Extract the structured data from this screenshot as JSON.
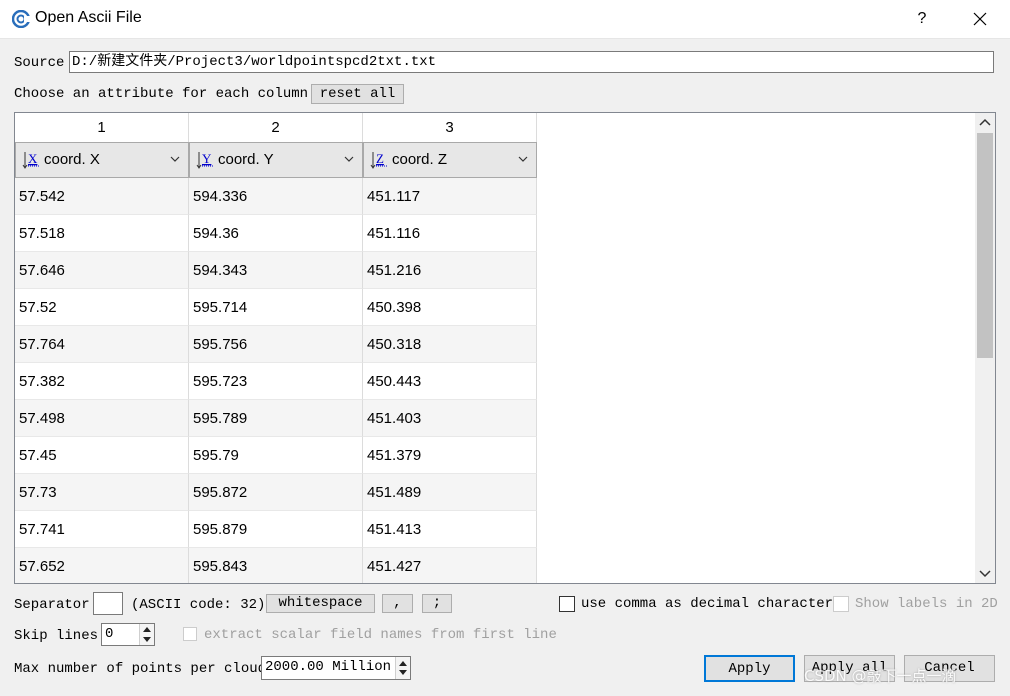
{
  "window": {
    "title": "Open Ascii File",
    "help": "?",
    "close_icon": "close-icon",
    "app_icon": "cloudcompare-icon"
  },
  "source": {
    "label": "Source",
    "value": "D:/新建文件夹/Project3/worldpointspcd2txt.txt"
  },
  "attributes": {
    "label": "Choose an attribute for each column:",
    "reset_label": "reset all"
  },
  "columns": [
    {
      "number": "1",
      "axis": "X",
      "label": "coord. X"
    },
    {
      "number": "2",
      "axis": "Y",
      "label": "coord. Y"
    },
    {
      "number": "3",
      "axis": "Z",
      "label": "coord. Z"
    }
  ],
  "rows": [
    [
      "57.542",
      "594.336",
      "451.117"
    ],
    [
      "57.518",
      "594.36",
      "451.116"
    ],
    [
      "57.646",
      "594.343",
      "451.216"
    ],
    [
      "57.52",
      "595.714",
      "450.398"
    ],
    [
      "57.764",
      "595.756",
      "450.318"
    ],
    [
      "57.382",
      "595.723",
      "450.443"
    ],
    [
      "57.498",
      "595.789",
      "451.403"
    ],
    [
      "57.45",
      "595.79",
      "451.379"
    ],
    [
      "57.73",
      "595.872",
      "451.489"
    ],
    [
      "57.741",
      "595.879",
      "451.413"
    ],
    [
      "57.652",
      "595.843",
      "451.427"
    ]
  ],
  "separator": {
    "label": "Separator",
    "value": "",
    "code_text": "(ASCII code: 32)",
    "whitespace_label": "whitespace",
    "comma_label": ",",
    "semicolon_label": ";"
  },
  "options": {
    "comma_decimal": "use comma as decimal character",
    "show_labels": "Show labels in 2D",
    "extract_names": "extract scalar field names from first line"
  },
  "skip": {
    "label": "Skip lines",
    "value": "0"
  },
  "max_points": {
    "label": "Max number of points per cloud",
    "value": "2000.00 Million"
  },
  "buttons": {
    "apply": "Apply",
    "apply_all": "Apply all",
    "cancel": "Cancel"
  },
  "watermark": "CSDN @敲下一点一滴",
  "colors": {
    "accent": "#0078d7",
    "axis_link": "#0000cc"
  }
}
